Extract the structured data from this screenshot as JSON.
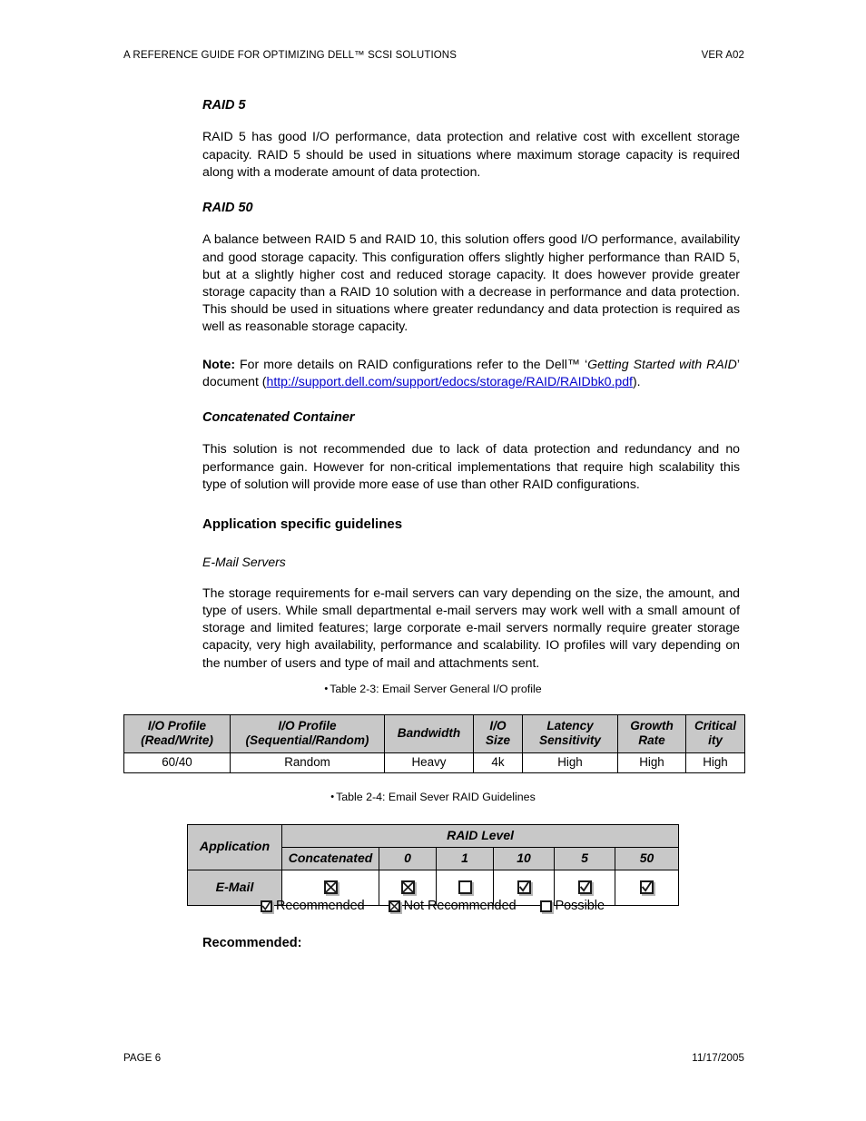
{
  "header": {
    "left": "A REFERENCE GUIDE FOR OPTIMIZING DELL™ SCSI SOLUTIONS",
    "right": "VER A02"
  },
  "footer": {
    "left": "PAGE 6",
    "right": "11/17/2005"
  },
  "sections": {
    "raid5": {
      "heading": "RAID 5",
      "body": "RAID 5 has good I/O performance, data protection and relative cost with excellent storage capacity.   RAID 5 should be used in situations where maximum storage capacity is required along with a moderate amount of data protection."
    },
    "raid50": {
      "heading": "RAID 50",
      "body": "A balance between RAID 5 and RAID 10, this solution offers good I/O performance, availability and good storage capacity. This configuration offers slightly higher performance than RAID 5, but at a slightly higher cost and reduced storage capacity.  It does however provide greater storage capacity than a RAID 10 solution with a decrease in performance and data protection.   This should be used in situations where greater redundancy and data protection is required as well as reasonable storage capacity."
    },
    "note": {
      "label": "Note:",
      "text_before": " For more details on RAID configurations refer to the Dell™ ‘",
      "doc_title": "Getting Started with RAID",
      "text_mid": "’ document (",
      "link_text": "http://support.dell.com/support/edocs/storage/RAID/RAIDbk0.pdf",
      "link_href": "http://support.dell.com/support/edocs/storage/RAID/RAIDbk0.pdf",
      "text_after": ")."
    },
    "concatenated": {
      "heading": "Concatenated Container",
      "body": "This solution is not recommended due to lack of data protection and redundancy and no performance gain.  However for non-critical implementations that require high scalability this type of solution will provide more ease of use than other RAID configurations."
    },
    "app_guidelines": {
      "heading": "Application specific guidelines"
    },
    "email_servers": {
      "heading": "E-Mail Servers",
      "body": "The storage requirements for e-mail servers can vary depending on the size, the amount, and type of users. While small departmental e-mail servers may work well with a small amount of storage and limited features; large corporate e-mail servers normally require greater storage capacity, very high availability, performance and scalability. IO profiles will vary depending on the number of users and type of mail and attachments sent."
    },
    "recommended_heading": "Recommended:"
  },
  "table_io": {
    "caption_bullet": "•",
    "caption": "Table 2-3: Email Server General I/O profile",
    "headers": [
      "I/O Profile\n(Read/Write)",
      "I/O Profile\n(Sequential/Random)",
      "Bandwidth",
      "I/O\nSize",
      "Latency\nSensitivity",
      "Growth\nRate",
      "Critical\nity"
    ],
    "headers_lines": [
      [
        "I/O Profile",
        "(Read/Write)"
      ],
      [
        "I/O Profile",
        "(Sequential/Random)"
      ],
      [
        "Bandwidth",
        ""
      ],
      [
        "I/O",
        "Size"
      ],
      [
        "Latency",
        "Sensitivity"
      ],
      [
        "Growth",
        "Rate"
      ],
      [
        "Critical",
        "ity"
      ]
    ],
    "row": [
      "60/40",
      "Random",
      "Heavy",
      "4k",
      "High",
      "High",
      "High"
    ]
  },
  "table_raid": {
    "caption_bullet": "•",
    "caption": "Table 2-4: Email Sever RAID Guidelines",
    "app_header": "Application",
    "group_header": "RAID Level",
    "level_headers": [
      "Concatenated",
      "0",
      "1",
      "10",
      "5",
      "50"
    ],
    "row_label": "E-Mail",
    "row_marks": [
      "x",
      "x",
      "empty",
      "check",
      "check",
      "check"
    ],
    "legend": [
      {
        "mark": "check",
        "label": "Recommended"
      },
      {
        "mark": "x",
        "label": "Not Recommended"
      },
      {
        "mark": "empty",
        "label": "Possible"
      }
    ]
  },
  "colors": {
    "header_fill": "#c8c8c8",
    "link": "#0000cc",
    "text": "#000000"
  }
}
